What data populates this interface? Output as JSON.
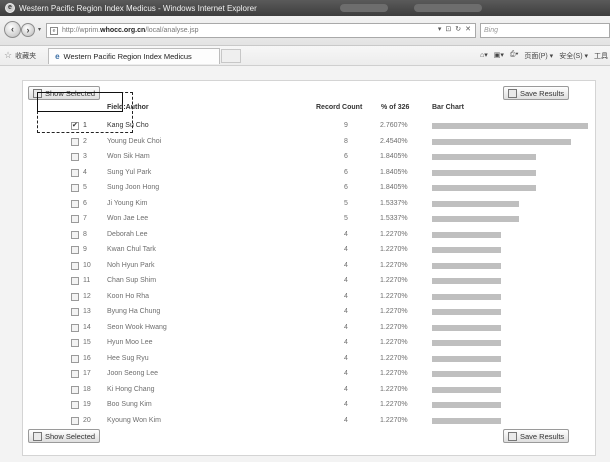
{
  "window": {
    "title": "Western Pacific Region Index Medicus - Windows Internet Explorer"
  },
  "address": {
    "prefix": "http://wprim.",
    "domain": "whocc.org.cn",
    "path": "/local/analyse.jsp"
  },
  "search": {
    "placeholder": "Bing"
  },
  "favorites": {
    "label": "收藏夹"
  },
  "tab": {
    "label": "Western Pacific Region Index Medicus"
  },
  "toolbar_right": {
    "page": "页面(P) ▾",
    "safety": "安全(S) ▾",
    "tools": "工具"
  },
  "buttons": {
    "show_selected": "Show Selected",
    "save_results": "Save Results"
  },
  "table": {
    "headers": {
      "field": "Field:Author",
      "count": "Record Count",
      "pct": "% of 326",
      "chart": "Bar Chart"
    },
    "rows": [
      {
        "num": "1",
        "name": "Kang Su Cho",
        "count": "9",
        "pct": "2.7607%",
        "fraction": 1.0,
        "checked": true
      },
      {
        "num": "2",
        "name": "Young Deuk Choi",
        "count": "8",
        "pct": "2.4540%",
        "fraction": 0.889,
        "checked": false
      },
      {
        "num": "3",
        "name": "Won Sik Ham",
        "count": "6",
        "pct": "1.8405%",
        "fraction": 0.667,
        "checked": false
      },
      {
        "num": "4",
        "name": "Sung Yul Park",
        "count": "6",
        "pct": "1.8405%",
        "fraction": 0.667,
        "checked": false
      },
      {
        "num": "5",
        "name": "Sung Joon Hong",
        "count": "6",
        "pct": "1.8405%",
        "fraction": 0.667,
        "checked": false
      },
      {
        "num": "6",
        "name": "Ji Young Kim",
        "count": "5",
        "pct": "1.5337%",
        "fraction": 0.556,
        "checked": false
      },
      {
        "num": "7",
        "name": "Won Jae Lee",
        "count": "5",
        "pct": "1.5337%",
        "fraction": 0.556,
        "checked": false
      },
      {
        "num": "8",
        "name": "Deborah Lee",
        "count": "4",
        "pct": "1.2270%",
        "fraction": 0.444,
        "checked": false
      },
      {
        "num": "9",
        "name": "Kwan Chul Tark",
        "count": "4",
        "pct": "1.2270%",
        "fraction": 0.444,
        "checked": false
      },
      {
        "num": "10",
        "name": "Noh Hyun Park",
        "count": "4",
        "pct": "1.2270%",
        "fraction": 0.444,
        "checked": false
      },
      {
        "num": "11",
        "name": "Chan Sup Shim",
        "count": "4",
        "pct": "1.2270%",
        "fraction": 0.444,
        "checked": false
      },
      {
        "num": "12",
        "name": "Koon Ho Rha",
        "count": "4",
        "pct": "1.2270%",
        "fraction": 0.444,
        "checked": false
      },
      {
        "num": "13",
        "name": "Byung Ha Chung",
        "count": "4",
        "pct": "1.2270%",
        "fraction": 0.444,
        "checked": false
      },
      {
        "num": "14",
        "name": "Seon Wook Hwang",
        "count": "4",
        "pct": "1.2270%",
        "fraction": 0.444,
        "checked": false
      },
      {
        "num": "15",
        "name": "Hyun Moo Lee",
        "count": "4",
        "pct": "1.2270%",
        "fraction": 0.444,
        "checked": false
      },
      {
        "num": "16",
        "name": "Hee Sug Ryu",
        "count": "4",
        "pct": "1.2270%",
        "fraction": 0.444,
        "checked": false
      },
      {
        "num": "17",
        "name": "Joon Seong Lee",
        "count": "4",
        "pct": "1.2270%",
        "fraction": 0.444,
        "checked": false
      },
      {
        "num": "18",
        "name": "Ki Hong Chang",
        "count": "4",
        "pct": "1.2270%",
        "fraction": 0.444,
        "checked": false
      },
      {
        "num": "19",
        "name": "Boo Sung Kim",
        "count": "4",
        "pct": "1.2270%",
        "fraction": 0.444,
        "checked": false
      },
      {
        "num": "20",
        "name": "Kyoung Won Kim",
        "count": "4",
        "pct": "1.2270%",
        "fraction": 0.444,
        "checked": false
      }
    ]
  }
}
